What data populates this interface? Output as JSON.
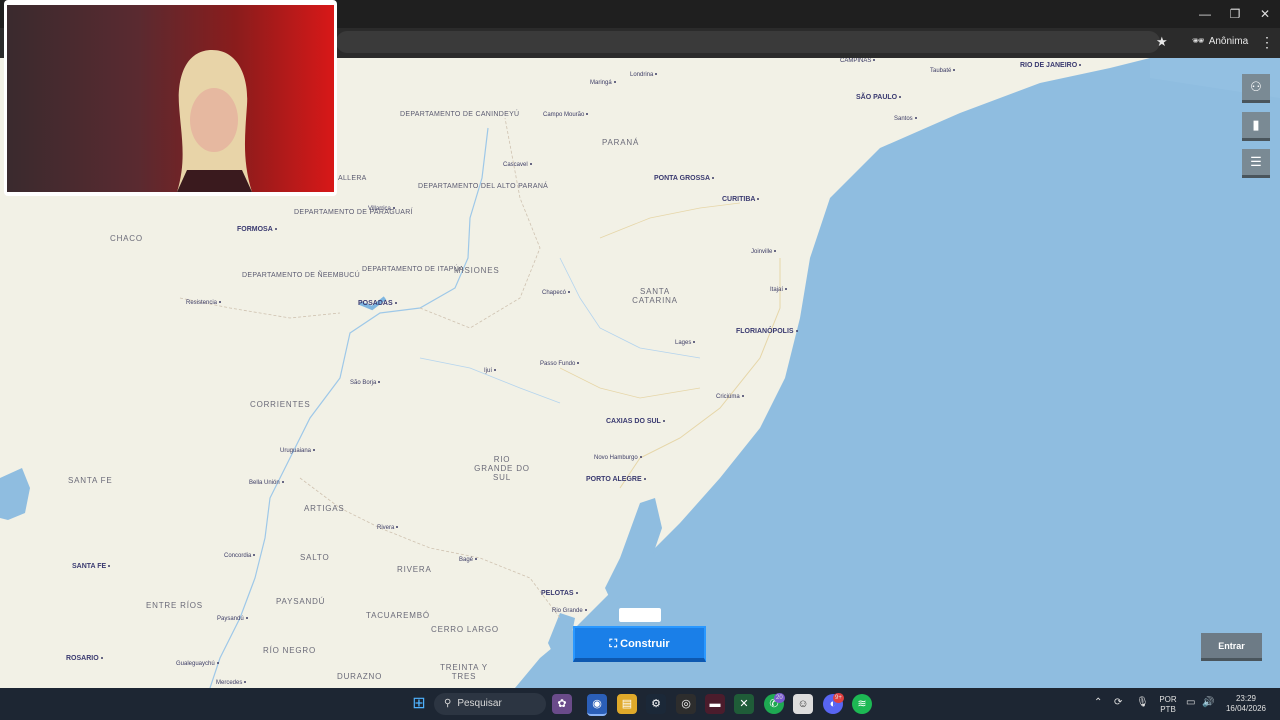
{
  "window": {
    "minimize": "—",
    "restore": "❐",
    "close": "✕"
  },
  "toolbar": {
    "star_icon": "★",
    "incognito_label": "Anônima",
    "menu_icon": "⋮"
  },
  "map": {
    "region_labels": [
      "DEPARTAMENTO DE CANINDEYÚ",
      "PARANÁ",
      "DEPARTAMENTO DEL ALTO PARANÁ",
      "DEPARTAMENTO DE PARAGUARÍ",
      "CHACO",
      "DEPARTAMENTO DE ÑEEMBUCÚ",
      "DEPARTAMENTO DE ITAPÚA",
      "MISIONES",
      "SANTA CATARINA",
      "CORRIENTES",
      "RIO GRANDE DO SUL",
      "SANTA FE",
      "ARTIGAS",
      "SALTO",
      "RIVERA",
      "PAYSANDÚ",
      "TACUAREMBÓ",
      "ENTRE RÍOS",
      "RÍO NEGRO",
      "CERRO LARGO",
      "DURAZNO",
      "TREINTA Y TRES",
      "ALLERA"
    ],
    "cities": [
      "CAMPINAS",
      "Taubaté",
      "RIO DE JANEIRO",
      "SÃO PAULO",
      "Santos",
      "Londrina",
      "Maringá",
      "Campo Mourão",
      "Cascavel",
      "PONTA GROSSA",
      "CURITIBA",
      "Joinville",
      "Itajaí",
      "FLORIANÓPOLIS",
      "Chapecó",
      "Lages",
      "Passo Fundo",
      "Criciúma",
      "CAXIAS DO SUL",
      "Novo Hamburgo",
      "PORTO ALEGRE",
      "FORMOSA",
      "Villarrica",
      "Resistencia",
      "POSADAS",
      "São Borja",
      "Ijuí",
      "Uruguaiana",
      "Bella Unión",
      "Rivera",
      "Concordia",
      "SANTA FE",
      "Bagé",
      "PELOTAS",
      "Rio Grande",
      "Paysandú",
      "ROSARIO",
      "Gualeguaychú",
      "Mercedes"
    ]
  },
  "webcam": {},
  "game_ui": {
    "side_buttons": [
      "⚇",
      "▮",
      "☰"
    ],
    "construir_label": "Construir",
    "construir_icon": "⛶",
    "entrar_label": "Entrar"
  },
  "taskbar": {
    "search_placeholder": "Pesquisar",
    "lang_top": "POR",
    "lang_bottom": "PTB",
    "time": "23:29",
    "date": "16/04/2026",
    "whatsapp_badge": "20",
    "discord_badge": "9+"
  }
}
